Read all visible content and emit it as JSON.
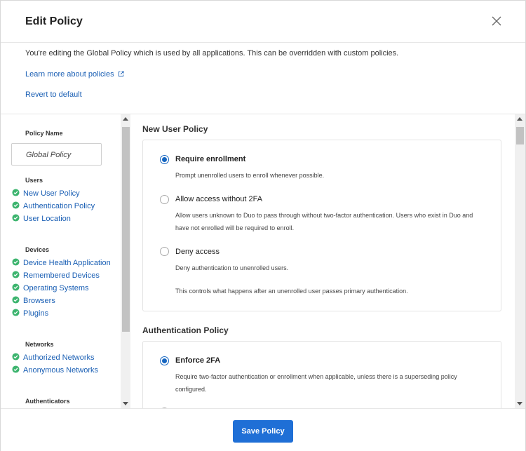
{
  "header": {
    "title": "Edit Policy"
  },
  "intro": {
    "text": "You're editing the Global Policy which is used by all applications. This can be overridden with custom policies.",
    "learn_more": "Learn more about policies",
    "revert": "Revert to default"
  },
  "sidebar": {
    "policy_name_label": "Policy Name",
    "policy_name_value": "Global Policy",
    "groups": [
      {
        "title": "Users",
        "items": [
          "New User Policy",
          "Authentication Policy",
          "User Location"
        ]
      },
      {
        "title": "Devices",
        "items": [
          "Device Health Application",
          "Remembered Devices",
          "Operating Systems",
          "Browsers",
          "Plugins"
        ]
      },
      {
        "title": "Networks",
        "items": [
          "Authorized Networks",
          "Anonymous Networks"
        ]
      },
      {
        "title": "Authenticators",
        "items": []
      }
    ]
  },
  "main": {
    "new_user_policy": {
      "title": "New User Policy",
      "options": [
        {
          "label": "Require enrollment",
          "selected": true,
          "desc": "Prompt unenrolled users to enroll whenever possible."
        },
        {
          "label": "Allow access without 2FA",
          "selected": false,
          "desc": "Allow users unknown to Duo to pass through without two-factor authentication. Users who exist in Duo and have not enrolled will be required to enroll."
        },
        {
          "label": "Deny access",
          "selected": false,
          "desc": "Deny authentication to unenrolled users."
        }
      ],
      "note": "This controls what happens after an unenrolled user passes primary authentication."
    },
    "authentication_policy": {
      "title": "Authentication Policy",
      "options": [
        {
          "label": "Enforce 2FA",
          "selected": true,
          "desc": "Require two-factor authentication or enrollment when applicable, unless there is a superseding policy configured."
        }
      ]
    }
  },
  "footer": {
    "save": "Save Policy"
  },
  "colors": {
    "link": "#1a5fb4",
    "check": "#3cb46e",
    "primary": "#1f6fd6"
  }
}
